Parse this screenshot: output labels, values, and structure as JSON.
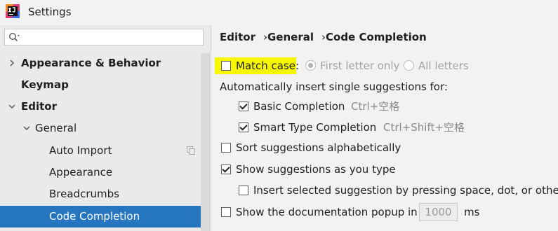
{
  "window": {
    "title": "Settings"
  },
  "sidebar": {
    "search_placeholder": "",
    "items": [
      {
        "label": "Appearance & Behavior",
        "expanded": false
      },
      {
        "label": "Keymap"
      },
      {
        "label": "Editor",
        "expanded": true
      },
      {
        "label": "General",
        "expanded": true
      },
      {
        "label": "Auto Import"
      },
      {
        "label": "Appearance"
      },
      {
        "label": "Breadcrumbs"
      },
      {
        "label": "Code Completion",
        "selected": true
      }
    ]
  },
  "breadcrumb": [
    "Editor",
    "General",
    "Code Completion"
  ],
  "options": {
    "match_case": {
      "label": "Match case:",
      "checked": false
    },
    "first_letter_only": {
      "label": "First letter only",
      "selected": true
    },
    "all_letters": {
      "label": "All letters",
      "selected": false
    },
    "auto_insert_label": "Automatically insert single suggestions for:",
    "basic_completion": {
      "label": "Basic Completion",
      "shortcut": "Ctrl+空格",
      "checked": true
    },
    "smart_type_completion": {
      "label": "Smart Type Completion",
      "shortcut": "Ctrl+Shift+空格",
      "checked": true
    },
    "sort_alphabetically": {
      "label": "Sort suggestions alphabetically",
      "checked": false
    },
    "show_as_you_type": {
      "label": "Show suggestions as you type",
      "checked": true
    },
    "insert_by_space": {
      "label": "Insert selected suggestion by pressing space, dot, or other c",
      "checked": false
    },
    "doc_popup": {
      "label": "Show the documentation popup in",
      "value": "1000",
      "unit": "ms",
      "checked": false
    }
  },
  "colors": {
    "selection": "#2675bf",
    "highlight": "#f7f700"
  }
}
